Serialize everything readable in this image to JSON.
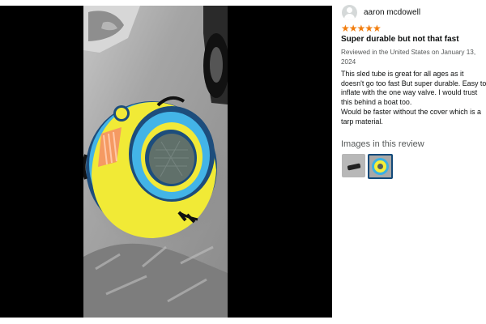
{
  "review": {
    "reviewer_name": "aaron mcdowell",
    "stars_text": "★★★★★",
    "headline": "Super durable but not that fast",
    "meta": "Reviewed in the United States on January 13, 2024",
    "body_lines": [
      "This sled tube is great for all ages as it doesn't go too fast But super durable. Easy to inflate with the one way valve. I would trust this behind a boat too.",
      "Would be faster without the cover which is a tarp material."
    ],
    "images_heading": "Images in this review"
  },
  "ui": {
    "accent_star": "#f27e0f",
    "selected_border": "#124a7a",
    "photo_colors": [
      "#3ab0e3",
      "#f6ef38",
      "#f59a62",
      "#1d4d7c"
    ],
    "icons": [
      "avatar-icon",
      "star-icon",
      "thumbnail-image"
    ]
  }
}
